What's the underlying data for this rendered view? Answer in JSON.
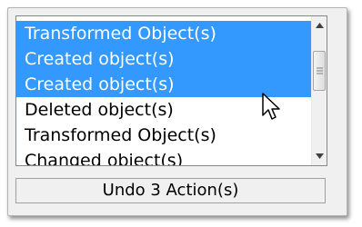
{
  "undo_list": {
    "items": [
      {
        "label": "Transformed Object(s)",
        "selected": true
      },
      {
        "label": "Created object(s)",
        "selected": true
      },
      {
        "label": "Created object(s)",
        "selected": true
      },
      {
        "label": "Deleted object(s)",
        "selected": false
      },
      {
        "label": "Transformed Object(s)",
        "selected": false
      },
      {
        "label": "Changed object(s)",
        "selected": false
      }
    ],
    "selection_color": "#3399ff"
  },
  "scrollbar": {
    "up_icon": "arrow-up-icon",
    "down_icon": "arrow-down-icon",
    "thumb_icon": "grip-icon"
  },
  "undo_button": {
    "label": "Undo 3 Action(s)"
  },
  "cursor": {
    "icon": "mouse-pointer-icon"
  }
}
